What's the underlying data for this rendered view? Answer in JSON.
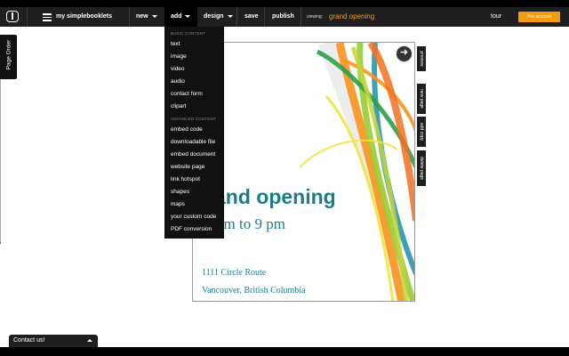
{
  "toolbar": {
    "brand": "my simplebooklets",
    "new_label": "new",
    "add_label": "add",
    "design_label": "design",
    "save_label": "save",
    "publish_label": "publish",
    "viewing_label": "viewing:",
    "viewing_title": "grand opening",
    "tour_label": "tour",
    "pro_label": "Pro account"
  },
  "add_menu": {
    "basic_header": "BASIC CONTENT",
    "basic_items": [
      "text",
      "image",
      "video",
      "audio",
      "contact form",
      "clipart"
    ],
    "advanced_header": "ADVANCED CONTENT",
    "advanced_items": [
      "embed code",
      "downloadable file",
      "embed document",
      "website page",
      "link hotspot",
      "shapes",
      "maps",
      "your custom code",
      "PDF conversion"
    ]
  },
  "page_order": {
    "label": "Page Order"
  },
  "page": {
    "heading": "and opening",
    "subheading": "am to 9 pm",
    "address_line1": "1111 Circle Route",
    "address_line2": "Vancouver, British Columbia"
  },
  "side_tabs": [
    "preview",
    "new page",
    "add copy",
    "delete page"
  ],
  "contact": {
    "label": "Contact us!"
  },
  "colors": {
    "accent": "#f39c12",
    "toolbar": "#1f1f1f",
    "heading": "#1b7d8c"
  }
}
